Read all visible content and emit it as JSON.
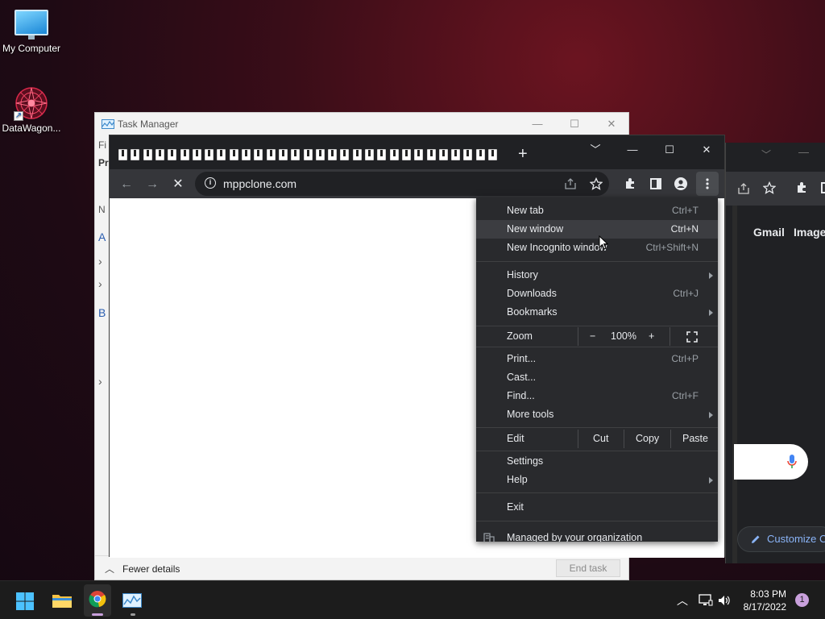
{
  "desktop": {
    "icons": [
      {
        "label": "My Computer"
      },
      {
        "label": "DataWagon..."
      }
    ]
  },
  "task_manager": {
    "title": "Task Manager",
    "side_fragments": [
      "Fi",
      "Pr",
      "N",
      "A",
      "›",
      "›",
      "B",
      "›"
    ],
    "fewer_details": "Fewer details",
    "end_task": "End task"
  },
  "chrome_back": {
    "gmail": "Gmail",
    "images": "Images",
    "customize": "Customize C"
  },
  "chrome": {
    "new_tab_glyph": "+",
    "url": "mppclone.com",
    "tab_icon_count": 31
  },
  "menu": {
    "items1": [
      {
        "label": "New tab",
        "shortcut": "Ctrl+T"
      },
      {
        "label": "New window",
        "shortcut": "Ctrl+N"
      },
      {
        "label": "New Incognito window",
        "shortcut": "Ctrl+Shift+N"
      }
    ],
    "items2": [
      {
        "label": "History",
        "shortcut": ""
      },
      {
        "label": "Downloads",
        "shortcut": "Ctrl+J"
      },
      {
        "label": "Bookmarks",
        "shortcut": ""
      }
    ],
    "zoom": {
      "label": "Zoom",
      "minus": "−",
      "value": "100%",
      "plus": "+"
    },
    "items3": [
      {
        "label": "Print...",
        "shortcut": "Ctrl+P"
      },
      {
        "label": "Cast...",
        "shortcut": ""
      },
      {
        "label": "Find...",
        "shortcut": "Ctrl+F"
      },
      {
        "label": "More tools",
        "shortcut": ""
      }
    ],
    "edit": {
      "label": "Edit",
      "cut": "Cut",
      "copy": "Copy",
      "paste": "Paste"
    },
    "items4": [
      {
        "label": "Settings"
      },
      {
        "label": "Help"
      }
    ],
    "exit": "Exit",
    "managed": "Managed by your organization"
  },
  "taskbar": {
    "time": "8:03 PM",
    "date": "8/17/2022",
    "notifications": "1"
  }
}
